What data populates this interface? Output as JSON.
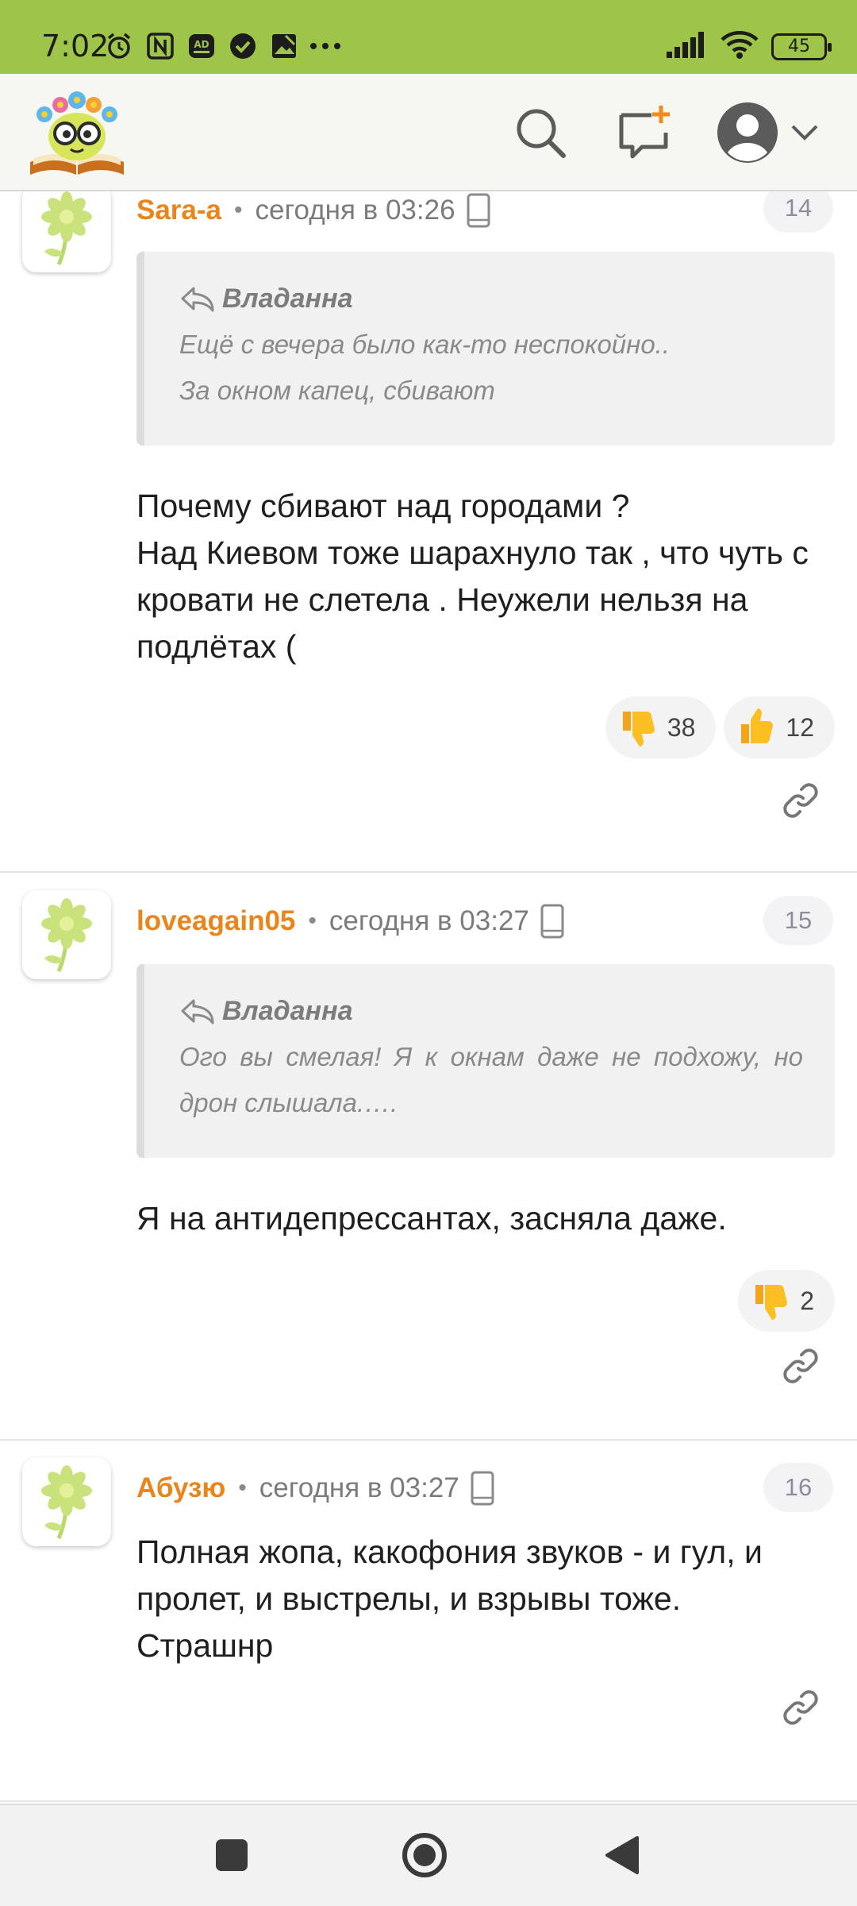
{
  "status_bar": {
    "time": "7:02",
    "battery": "45",
    "left_icons": [
      "alarm-icon",
      "nfc-icon",
      "ad-blocker-icon",
      "check-circle-icon",
      "gallery-icon",
      "more-dots-icon"
    ],
    "right_icons": [
      "signal-icon",
      "wifi-icon",
      "battery-icon"
    ]
  },
  "header": {
    "logo_icon": "book-mascot-logo",
    "search_icon": "search-icon",
    "new_post_icon": "new-message-icon",
    "profile_icon": "avatar-icon",
    "menu_icon": "chevron-down-icon"
  },
  "comments": [
    {
      "author": "Sara-a",
      "time": "сегодня в 03:26",
      "number": "14",
      "quote": {
        "author": "Владанна",
        "lines": [
          "Ещё с вечера было как-то неспокойно..",
          "За окном капец, сбивают"
        ]
      },
      "body_lines": [
        "Почему сбивают над городами ?",
        "Над Киевом тоже шарахнуло так , что чуть с кровати не слетела . Неужели нельзя на подлётах ("
      ],
      "dislikes": "38",
      "likes": "12"
    },
    {
      "author": "loveagain05",
      "time": "сегодня в 03:27",
      "number": "15",
      "quote": {
        "author": "Владанна",
        "lines": [
          "Ого вы смелая! Я к окнам даже не подхожу, но дрон слышала.…."
        ]
      },
      "body_lines": [
        "Я на антидепрессантах, засняла даже."
      ],
      "dislikes": "2"
    },
    {
      "author": "Абузю",
      "time": "сегодня в 03:27",
      "number": "16",
      "body_lines": [
        "Полная жопа, какофония звуков - и гул, и пролет, и выстрелы, и взрывы тоже.",
        "Страшнр"
      ]
    }
  ],
  "colors": {
    "status_bar": "#9ec44a",
    "author": "#e9851a",
    "header_bg": "#f7f7f2",
    "quote_bg": "#f1f1f1"
  }
}
